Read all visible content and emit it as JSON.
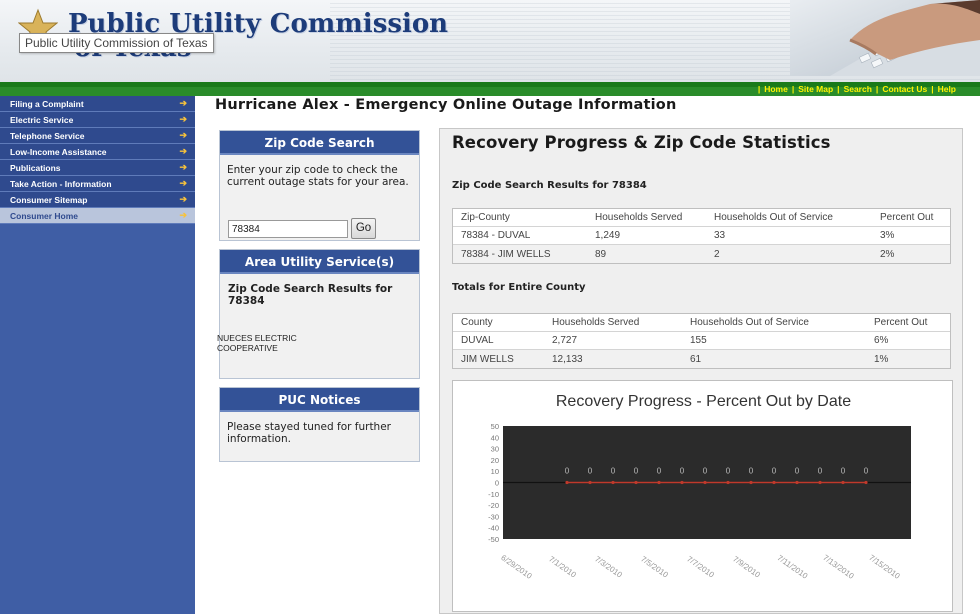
{
  "header": {
    "logo_line1": "Public Utility Commission",
    "logo_line2": "of Texas",
    "tooltip": "Public Utility Commission of Texas",
    "nav": [
      "Home",
      "Site Map",
      "Search",
      "Contact Us",
      "Help"
    ]
  },
  "sidebar": {
    "items": [
      {
        "label": "Filing a Complaint"
      },
      {
        "label": "Electric Service"
      },
      {
        "label": "Telephone Service"
      },
      {
        "label": "Low-Income Assistance"
      },
      {
        "label": "Publications"
      },
      {
        "label": "Take Action - Information"
      },
      {
        "label": "Consumer Sitemap"
      },
      {
        "label": "Consumer Home"
      }
    ],
    "arrow": "➔"
  },
  "page_title": "Hurricane Alex - Emergency Online Outage Information",
  "zip_search": {
    "heading": "Zip Code Search",
    "description": "Enter your zip code to check the current outage stats for your area.",
    "input_value": "78384",
    "go_label": "Go"
  },
  "area_utility": {
    "heading": "Area Utility Service(s)",
    "subtitle": "Zip Code Search Results for 78384",
    "company": "NUECES ELECTRIC COOPERATIVE"
  },
  "notices": {
    "heading": "PUC Notices",
    "text": "Please stayed tuned for further information."
  },
  "recovery": {
    "title": "Recovery Progress & Zip Code Statistics",
    "zip_results_title": "Zip Code Search Results for 78384",
    "zip_table": {
      "headers": [
        "Zip-County",
        "Households Served",
        "Households Out of Service",
        "Percent Out"
      ],
      "rows": [
        [
          "78384 - DUVAL",
          "1,249",
          "33",
          "3%"
        ],
        [
          "78384 - JIM WELLS",
          "89",
          "2",
          "2%"
        ]
      ]
    },
    "county_title": "Totals for Entire County",
    "county_table": {
      "headers": [
        "County",
        "Households Served",
        "Households Out of Service",
        "Percent Out"
      ],
      "rows": [
        [
          "DUVAL",
          "2,727",
          "155",
          "6%"
        ],
        [
          "JIM WELLS",
          "12,133",
          "61",
          "1%"
        ]
      ]
    }
  },
  "chart_data": {
    "type": "line",
    "title": "Recovery Progress - Percent Out by Date",
    "xlabel": "",
    "ylabel": "",
    "ylim": [
      -50,
      50
    ],
    "yticks": [
      50,
      40,
      30,
      20,
      10,
      0,
      -10,
      -20,
      -30,
      -40,
      -50
    ],
    "x_tick_labels": [
      "6/29/2010",
      "7/1/2010",
      "7/3/2010",
      "7/5/2010",
      "7/7/2010",
      "7/9/2010",
      "7/11/2010",
      "7/13/2010",
      "7/15/2010"
    ],
    "series": [
      {
        "x": [
          "7/1/2010",
          "7/2/2010",
          "7/3/2010",
          "7/4/2010",
          "7/5/2010",
          "7/6/2010",
          "7/7/2010",
          "7/8/2010",
          "7/9/2010",
          "7/10/2010",
          "7/11/2010",
          "7/12/2010",
          "7/13/2010",
          "7/14/2010"
        ],
        "values": [
          0,
          0,
          0,
          0,
          0,
          0,
          0,
          0,
          0,
          0,
          0,
          0,
          0,
          0
        ],
        "labels": [
          "0",
          "0",
          "0",
          "0",
          "0",
          "0",
          "0",
          "0",
          "0",
          "0",
          "0",
          "0",
          "0",
          "0"
        ]
      }
    ],
    "plot_background": "#2b2b2b",
    "line_color": "#c0392b",
    "grid": false,
    "legend": "none"
  }
}
